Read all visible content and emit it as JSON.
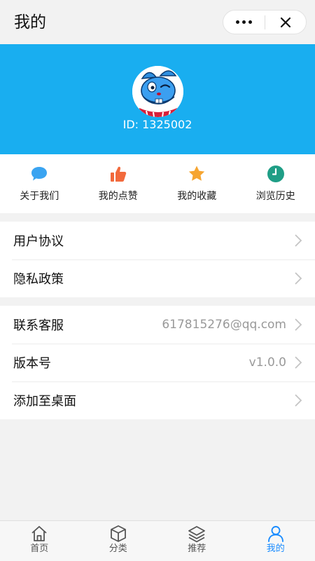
{
  "header": {
    "title": "我的"
  },
  "profile": {
    "id_text": "ID: 1325002"
  },
  "actions": [
    {
      "label": "关于我们",
      "icon": "chat-bubble-icon",
      "color": "#3aa4f1"
    },
    {
      "label": "我的点赞",
      "icon": "thumbs-up-icon",
      "color": "#f26a3d"
    },
    {
      "label": "我的收藏",
      "icon": "star-icon",
      "color": "#f6a531"
    },
    {
      "label": "浏览历史",
      "icon": "clock-icon",
      "color": "#1f9e86"
    }
  ],
  "group1": [
    {
      "label": "用户协议"
    },
    {
      "label": "隐私政策"
    }
  ],
  "group2": [
    {
      "label": "联系客服",
      "value": "617815276@qq.com"
    },
    {
      "label": "版本号",
      "value": "v1.0.0"
    },
    {
      "label": "添加至桌面",
      "value": ""
    }
  ],
  "tabs": [
    {
      "label": "首页",
      "icon": "home-icon"
    },
    {
      "label": "分类",
      "icon": "cube-icon"
    },
    {
      "label": "推荐",
      "icon": "layers-icon"
    },
    {
      "label": "我的",
      "icon": "user-icon"
    }
  ],
  "colors": {
    "banner": "#19aef0",
    "active_tab": "#1a8cff"
  }
}
